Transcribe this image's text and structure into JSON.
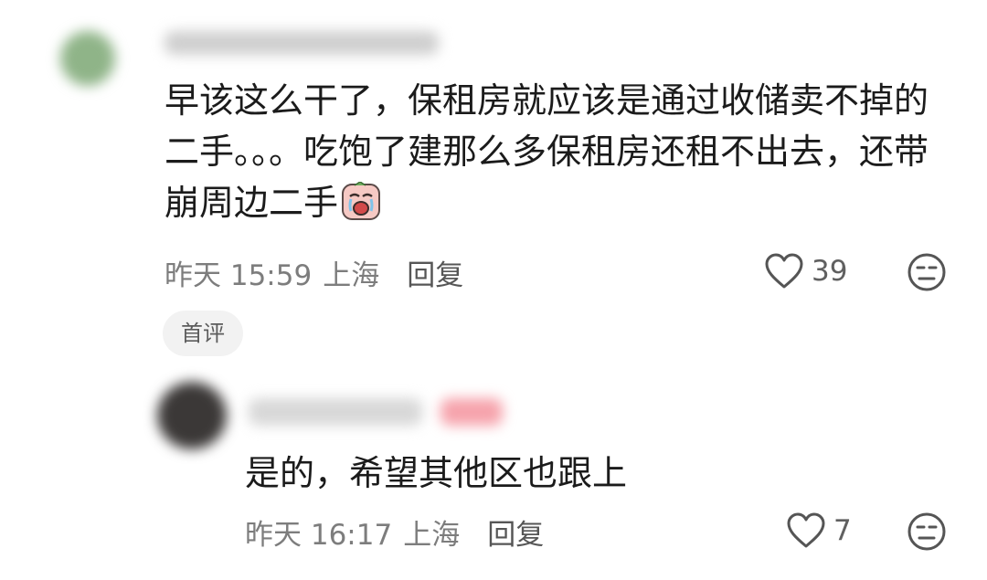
{
  "comment": {
    "text": "早该这么干了，保租房就应该是通过收储卖不掉的二手。。。吃饱了建那么多保租房还租不出去，还带崩周边二手",
    "emoji": "crying-face-sticker",
    "time": "昨天 15:59",
    "location": "上海",
    "reply_label": "回复",
    "like_count": "39",
    "tag": "首评"
  },
  "reply": {
    "text": "是的，希望其他区也跟上",
    "time": "昨天 16:17",
    "location": "上海",
    "reply_label": "回复",
    "like_count": "7"
  },
  "icons": {
    "like": "heart-outline-icon",
    "dislike": "neutral-face-icon"
  },
  "colors": {
    "text": "#1b1b1b",
    "meta": "#7d7d7d",
    "tag_bg": "#f2f2f2"
  }
}
